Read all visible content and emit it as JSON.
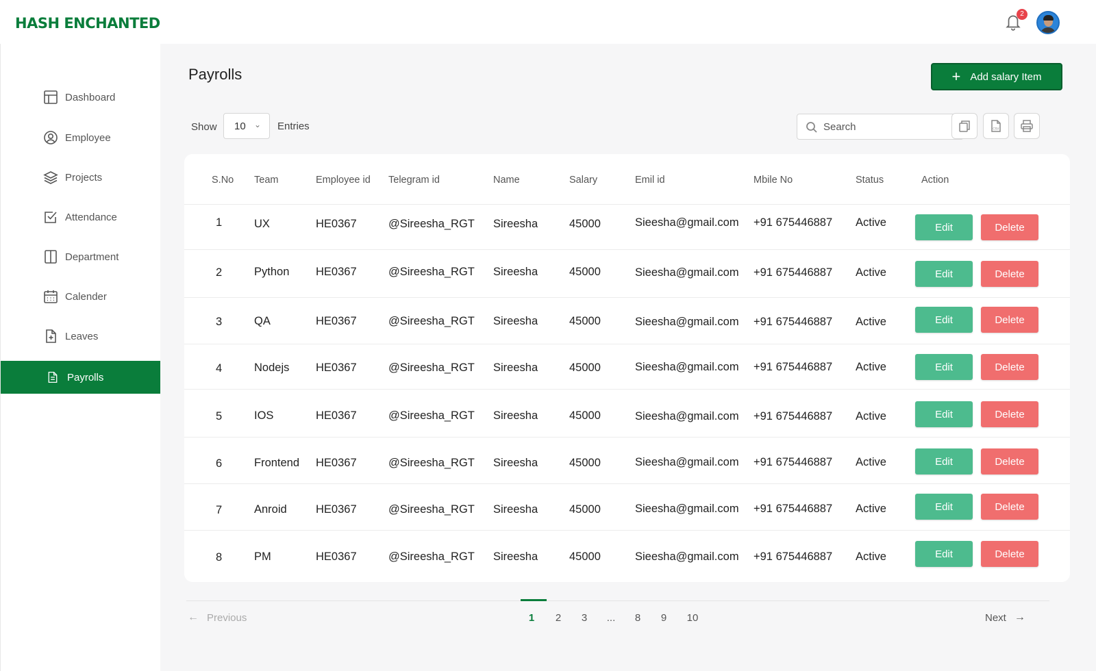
{
  "app": {
    "logo": "HASH ENCHANTED",
    "notification_count": "2"
  },
  "sidebar": {
    "items": [
      {
        "label": "Dashboard",
        "icon": "dashboard-icon"
      },
      {
        "label": "Employee",
        "icon": "user-circle-icon"
      },
      {
        "label": "Projects",
        "icon": "layers-icon"
      },
      {
        "label": "Attendance",
        "icon": "checkbox-icon"
      },
      {
        "label": "Department",
        "icon": "columns-icon"
      },
      {
        "label": "Calender",
        "icon": "calendar-icon"
      },
      {
        "label": "Leaves",
        "icon": "file-plus-icon"
      },
      {
        "label": "Payrolls",
        "icon": "document-icon",
        "active": true
      }
    ]
  },
  "page": {
    "title": "Payrolls",
    "add_button": "Add salary Item"
  },
  "controls": {
    "show_label": "Show",
    "entries_value": "10",
    "entries_label": "Entries",
    "search_placeholder": "Search",
    "csv_label": "CSV"
  },
  "table": {
    "columns": [
      "S.No",
      "Team",
      "Employee id",
      "Telegram id",
      "Name",
      "Salary",
      "Emil id",
      "Mbile No",
      "Status",
      "Action"
    ],
    "edit_label": "Edit",
    "delete_label": "Delete",
    "rows": [
      {
        "sno": "1",
        "team": "UX",
        "emp_id": "HE0367",
        "telegram": "@Sireesha_RGT",
        "name": "Sireesha",
        "salary": "45000",
        "email": "Sieesha@gmail.com",
        "mobile": "+91 675446887",
        "status": "Active"
      },
      {
        "sno": "2",
        "team": "Python",
        "emp_id": "HE0367",
        "telegram": "@Sireesha_RGT",
        "name": "Sireesha",
        "salary": "45000",
        "email": "Sieesha@gmail.com",
        "mobile": "+91 675446887",
        "status": "Active"
      },
      {
        "sno": "3",
        "team": "QA",
        "emp_id": "HE0367",
        "telegram": "@Sireesha_RGT",
        "name": "Sireesha",
        "salary": "45000",
        "email": "Sieesha@gmail.com",
        "mobile": "+91 675446887",
        "status": "Active"
      },
      {
        "sno": "4",
        "team": "Nodejs",
        "emp_id": "HE0367",
        "telegram": "@Sireesha_RGT",
        "name": "Sireesha",
        "salary": "45000",
        "email": "Sieesha@gmail.com",
        "mobile": "+91 675446887",
        "status": "Active"
      },
      {
        "sno": "5",
        "team": "IOS",
        "emp_id": "HE0367",
        "telegram": "@Sireesha_RGT",
        "name": "Sireesha",
        "salary": "45000",
        "email": "Sieesha@gmail.com",
        "mobile": "+91 675446887",
        "status": "Active"
      },
      {
        "sno": "6",
        "team": "Frontend",
        "emp_id": "HE0367",
        "telegram": "@Sireesha_RGT",
        "name": "Sireesha",
        "salary": "45000",
        "email": "Sieesha@gmail.com",
        "mobile": "+91 675446887",
        "status": "Active"
      },
      {
        "sno": "7",
        "team": "Anroid",
        "emp_id": "HE0367",
        "telegram": "@Sireesha_RGT",
        "name": "Sireesha",
        "salary": "45000",
        "email": "Sieesha@gmail.com",
        "mobile": "+91 675446887",
        "status": "Active"
      },
      {
        "sno": "8",
        "team": "PM",
        "emp_id": "HE0367",
        "telegram": "@Sireesha_RGT",
        "name": "Sireesha",
        "salary": "45000",
        "email": "Sieesha@gmail.com",
        "mobile": "+91 675446887",
        "status": "Active"
      }
    ]
  },
  "pagination": {
    "previous": "Previous",
    "next": "Next",
    "pages": [
      "1",
      "2",
      "3",
      "...",
      "8",
      "9",
      "10"
    ],
    "current": "1"
  },
  "colors": {
    "brand": "#0a7d3b",
    "edit": "#4dbb8e",
    "delete": "#f06e6e",
    "badge": "#e8434b"
  }
}
